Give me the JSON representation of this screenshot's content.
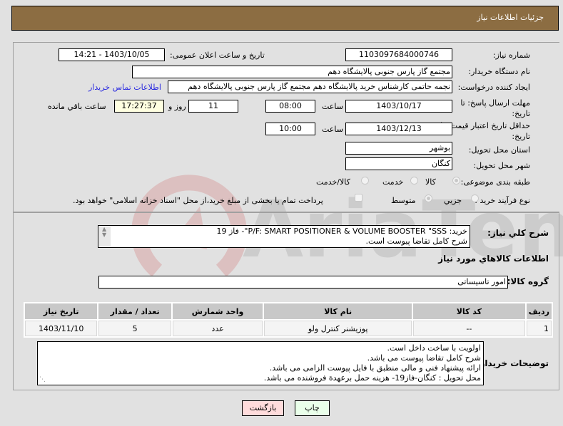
{
  "header": {
    "title": "جزئیات اطلاعات نیاز"
  },
  "form": {
    "need_number": {
      "label": "شماره نیاز:",
      "value": "1103097684000746"
    },
    "announce_datetime": {
      "label": "تاریخ و ساعت اعلان عمومی:",
      "value": "1403/10/05 - 14:21"
    },
    "buyer_org": {
      "label": "نام دستگاه خریدار:",
      "value": "مجتمع گاز پارس جنوبی  پالایشگاه دهم"
    },
    "requester": {
      "label": "ایجاد کننده درخواست:",
      "value": "نجمه حاتمی کارشناس خرید پالایشگاه دهم  مجتمع گاز پارس جنوبی  پالایشگاه دهم"
    },
    "buyer_contact_link": "اطلاعات تماس خریدار",
    "reply_deadline": {
      "label_line1": "مهلت ارسال پاسخ: تا",
      "label_line2": "تاریخ:",
      "date": "1403/10/17",
      "time_label": "ساعت",
      "time": "08:00",
      "days": "11",
      "days_label": "روز و",
      "remaining_time": "17:27:37",
      "remaining_label": "ساعت باقي مانده"
    },
    "price_validity": {
      "label_line1": "حداقل تاریخ اعتبار قیمت: تا",
      "label_line2": "تاریخ:",
      "date": "1403/12/13",
      "time_label": "ساعت",
      "time": "10:00"
    },
    "delivery_province": {
      "label": "استان محل تحویل:",
      "value": "بوشهر"
    },
    "delivery_city": {
      "label": "شهر محل تحویل:",
      "value": "کنگان"
    },
    "category": {
      "label": "طبقه بندی موضوعی:",
      "options": [
        {
          "label": "کالا",
          "checked": true
        },
        {
          "label": "خدمت",
          "checked": false
        },
        {
          "label": "کالا/خدمت",
          "checked": false
        }
      ]
    },
    "purchase_process": {
      "label": "نوع فرآیند خرید :",
      "options": [
        {
          "label": "جزیي",
          "checked": false
        },
        {
          "label": "متوسط",
          "checked": true
        }
      ],
      "treasury_checkbox_label": "پرداخت تمام یا بخشی از مبلغ خرید،از محل \"اسناد خزانه اسلامی\" خواهد بود.",
      "treasury_checked": false
    }
  },
  "details": {
    "summary_label": "شرح کلي نياز:",
    "summary_line1": "خرید: P/F: SMART POSITIONER & VOLUME BOOSTER \"SSS\"- فاز 19",
    "summary_line2": "شرح کامل تقاضا پیوست است.",
    "goods_info_title": "اطلاعات کالاهاي مورد نياز",
    "goods_group_label": "گروه کالا:",
    "goods_group_value": "امور تاسیساتی",
    "table": {
      "headers": [
        "ردیف",
        "کد کالا",
        "نام کالا",
        "واحد شمارش",
        "تعداد / مقدار",
        "تاریخ نیاز"
      ],
      "rows": [
        [
          "1",
          "--",
          "پوزیشنر کنترل ولو",
          "عدد",
          "5",
          "1403/11/10"
        ]
      ]
    },
    "buyer_notes_label": "توضیحات خریدار:",
    "buyer_notes": [
      "اولویت با ساخت داخل است.",
      "شرح کامل تقاضا پیوست می باشد.",
      "ارائه پیشنهاد فنی و مالی منطبق با فایل پیوست الزامی می باشد.",
      "محل تحویل : کنگان-فاز19- هزینه حمل برعهدة فروشنده می باشد."
    ]
  },
  "buttons": {
    "print": "چاپ",
    "back": "بازگشت"
  },
  "colors": {
    "header_bg": "#8c6d42",
    "print_bg": "#eaffea",
    "back_bg": "#ffdcdc",
    "link": "#2a2ae0"
  }
}
